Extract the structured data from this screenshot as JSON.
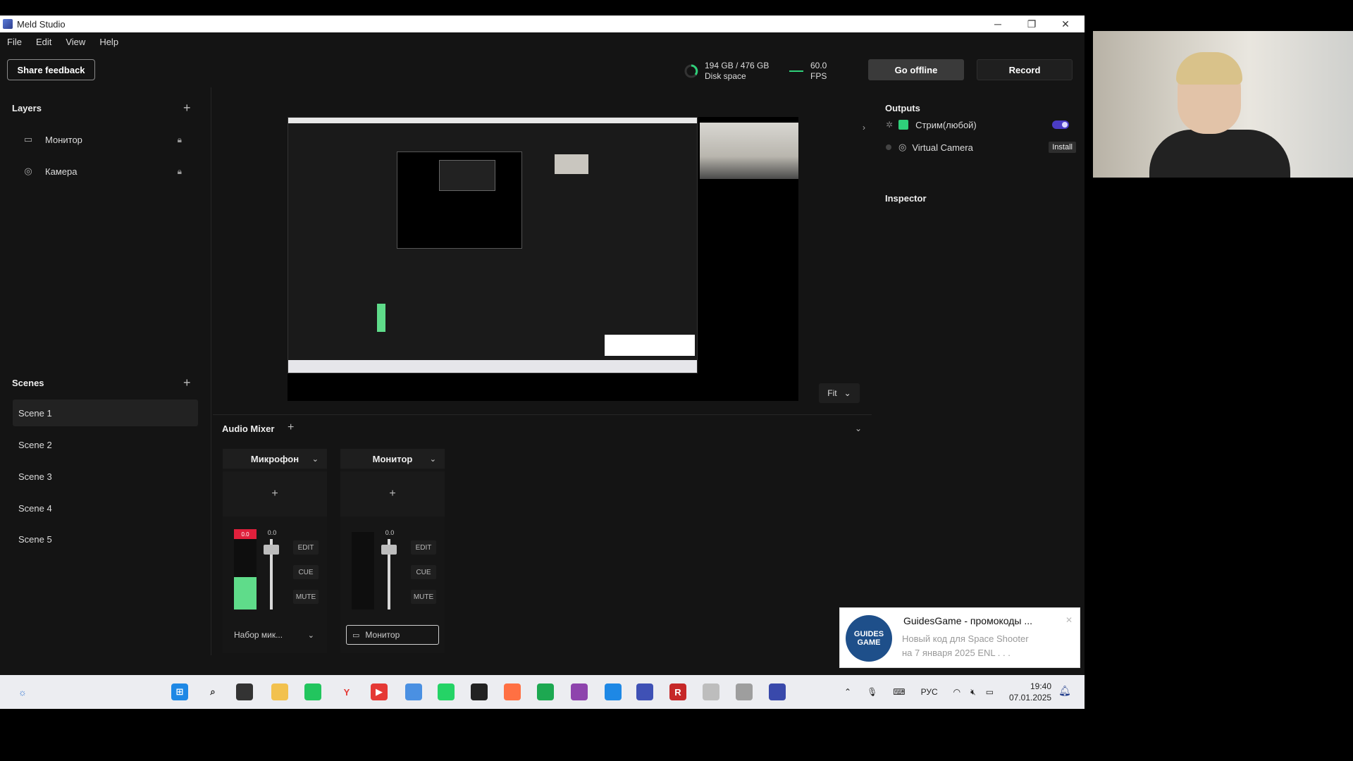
{
  "window": {
    "title": "Meld Studio",
    "minimize": "─",
    "maximize": "❐",
    "close": "✕"
  },
  "menu": [
    "File",
    "Edit",
    "View",
    "Help"
  ],
  "toolbar": {
    "share_feedback": "Share feedback",
    "disk_value": "194 GB / 476 GB",
    "disk_label": "Disk space",
    "fps_value": "60.0",
    "fps_label": "FPS",
    "go_offline": "Go offline",
    "record": "Record"
  },
  "layers": {
    "title": "Layers",
    "items": [
      {
        "label": "Монитор",
        "icon": "monitor-icon"
      },
      {
        "label": "Камера",
        "icon": "camera-icon"
      }
    ]
  },
  "scenes": {
    "title": "Scenes",
    "items": [
      "Scene 1",
      "Scene 2",
      "Scene 3",
      "Scene 4",
      "Scene 5"
    ],
    "active_index": 0
  },
  "preview": {
    "fit_label": "Fit"
  },
  "outputs": {
    "title": "Outputs",
    "items": [
      {
        "label": "Стрим(любой)",
        "enabled": true
      },
      {
        "label": "Virtual Camera",
        "action": "Install"
      }
    ]
  },
  "inspector": {
    "title": "Inspector"
  },
  "mixer": {
    "title": "Audio Mixer",
    "channels": [
      {
        "name": "Микрофон",
        "level": 0.42,
        "peak": "0.0",
        "fader": "0.0",
        "edit": "EDIT",
        "cue": "CUE",
        "mute": "MUTE",
        "device": "Набор мик..."
      },
      {
        "name": "Монитор",
        "level": 0.0,
        "fader": "0.0",
        "edit": "EDIT",
        "cue": "CUE",
        "mute": "MUTE",
        "device": "Монитор"
      }
    ]
  },
  "notification": {
    "logo_text": "GUIDES GAME",
    "title": "GuidesGame - промокоды ...",
    "line1": "Новый код для Space Shooter",
    "line2": "на 7 января 2025 ENL . . ."
  },
  "taskbar": {
    "lang": "РУС",
    "time": "19:40",
    "date": "07.01.2025"
  },
  "colors": {
    "accent": "#4b3cc4",
    "meter_green": "#5fdc8a",
    "peak_red": "#e0203c"
  }
}
